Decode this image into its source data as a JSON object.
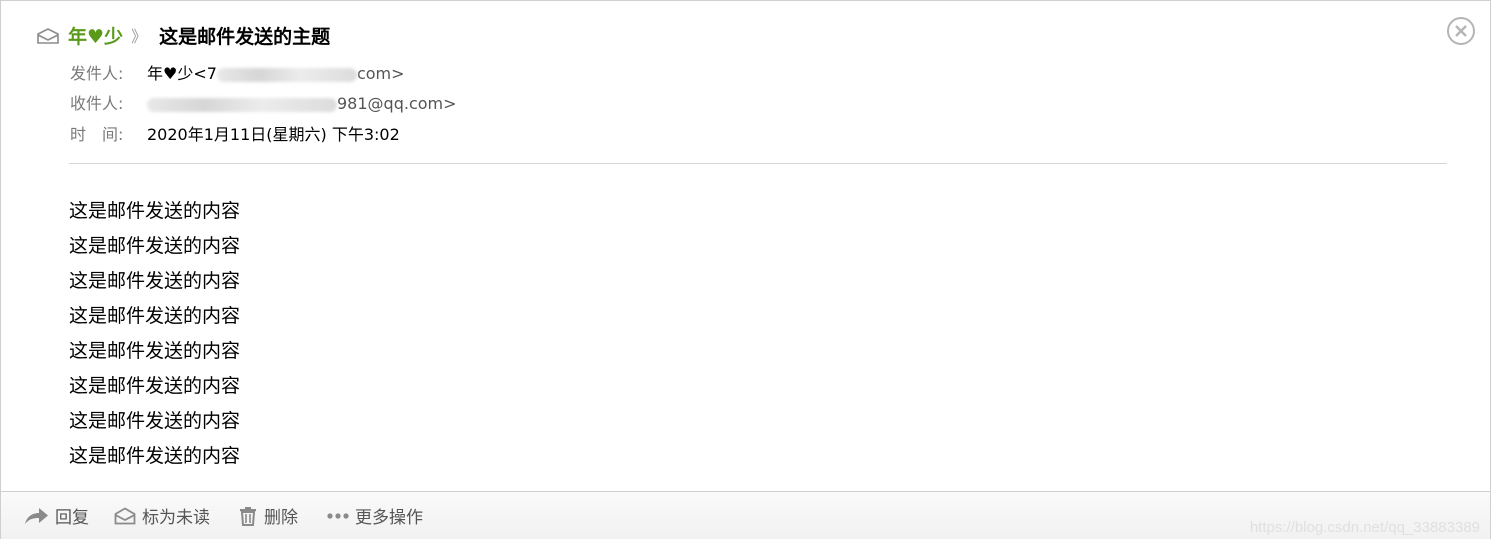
{
  "header": {
    "sender_name": "年♥少",
    "separator": "》",
    "subject": "这是邮件发送的主题"
  },
  "meta": {
    "from_label": "发件人:",
    "from_value_start": "年♥少<7",
    "from_value_end": "com>",
    "to_label": "收件人:",
    "to_value_end": "981@qq.com>",
    "time_label": "时　间:",
    "time_value": "2020年1月11日(星期六) 下午3:02"
  },
  "body": {
    "lines": [
      "这是邮件发送的内容",
      "这是邮件发送的内容",
      "这是邮件发送的内容",
      "这是邮件发送的内容",
      "这是邮件发送的内容",
      "这是邮件发送的内容",
      "这是邮件发送的内容",
      "这是邮件发送的内容"
    ]
  },
  "toolbar": {
    "reply": "回复",
    "mark_unread": "标为未读",
    "delete": "删除",
    "more": "更多操作"
  },
  "watermark": "https://blog.csdn.net/qq_33883389",
  "colors": {
    "sender": "#5a9a1a",
    "label": "#7a7a7a",
    "icon": "#9a9a9a"
  }
}
